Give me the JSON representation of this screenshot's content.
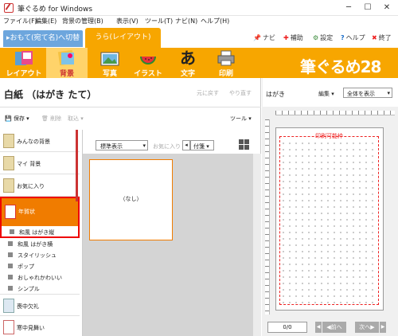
{
  "window": {
    "title": "筆ぐるめ for Windows",
    "minimize": "─",
    "maximize": "☐",
    "close": "✕"
  },
  "menu": [
    "ファイル(F)",
    "編集(E)",
    "背景の管理(B)",
    "表示(V)",
    "ツール(T)",
    "ナビ(N)",
    "ヘルプ(H)"
  ],
  "tabs": {
    "front": "▸おもて(宛て名)へ切替",
    "back": "うら(レイアウト)"
  },
  "right_tools": [
    {
      "icon": "📌",
      "label": "ナビ"
    },
    {
      "icon": "✚",
      "label": "補助"
    },
    {
      "icon": "⚙",
      "label": "設定"
    },
    {
      "icon": "?",
      "label": "ヘルプ"
    },
    {
      "icon": "✖",
      "label": "終了"
    }
  ],
  "toolbar": {
    "layout": "レイアウト",
    "background": "背景",
    "photo": "写真",
    "illust": "イラスト",
    "text": "文字",
    "print": "印刷",
    "brand": "筆ぐるめ28"
  },
  "page_title": "白紙 （はがき たて）",
  "undo": "元に戻す",
  "redo": "やり直す",
  "actions": {
    "save": "保存",
    "delete": "削除",
    "import": "取込",
    "tools": "ツール"
  },
  "filter": {
    "view_select": "標準表示",
    "favorite": "お気に入り",
    "tag": "付箋"
  },
  "categories": [
    {
      "label": "みんなの背景"
    },
    {
      "label": "マイ 背景"
    },
    {
      "label": "お気に入り"
    },
    {
      "label": "年賀状"
    },
    {
      "label": "喪中欠礼"
    },
    {
      "label": "寒中見舞い"
    }
  ],
  "subcategories": [
    "和風 はがき縦",
    "和風 はがき横",
    "スタイリッシュ",
    "ポップ",
    "おしゃれかわいい",
    "シンプル"
  ],
  "thumbnail": {
    "label": "（なし）"
  },
  "preview": {
    "paper": "はがき",
    "edit": "編集",
    "zoom": "全体を表示",
    "print_area": "印刷可能枠",
    "page_count": "0/0",
    "prev": "◀前へ",
    "next": "次へ▶"
  }
}
